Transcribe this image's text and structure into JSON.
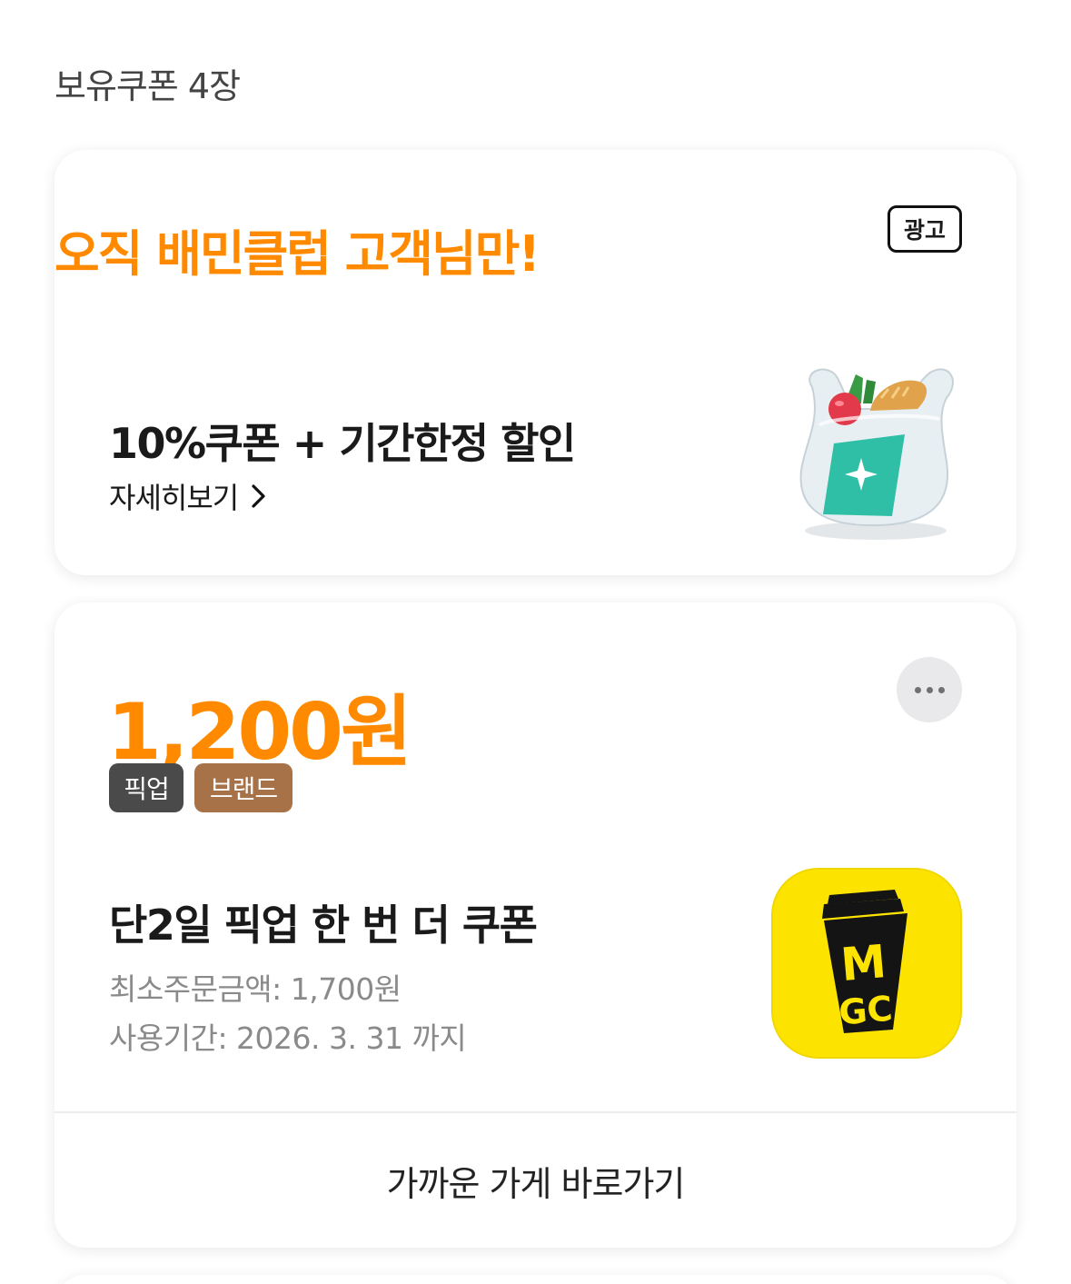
{
  "colors": {
    "accent": "#ff8a00",
    "pickup_tag": "#4a4a4a",
    "brand_tag": "#a87249",
    "logo_bg": "#fde300"
  },
  "header": {
    "title": "보유쿠폰 4장"
  },
  "ad_card": {
    "headline": "오직 배민클럽 고객님만!",
    "badge": "광고",
    "title": "10%쿠폰 + 기간한정 할인",
    "more_label": "자세히보기",
    "more_icon": "chevron-right-icon",
    "image": "grocery-bag-illustration"
  },
  "coupon_card": {
    "amount": "1,200원",
    "more_icon": "more-horizontal-icon",
    "tags": [
      "픽업",
      "브랜드"
    ],
    "title": "단2일 픽업 한 번 더 쿠폰",
    "min_order": "최소주문금액: 1,700원",
    "period": "사용기간: 2026. 3. 31 까지",
    "brand_logo": "mgc-coffee-logo",
    "logo_text": "MGC",
    "action_label": "가까운 가게 바로가기"
  }
}
